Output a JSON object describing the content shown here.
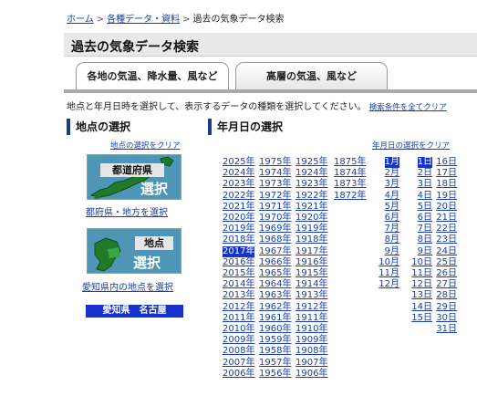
{
  "breadcrumb": {
    "home": "ホーム",
    "data": "各種データ・資料",
    "current": "過去の気象データ検索"
  },
  "page": {
    "title": "過去の気象データ検索"
  },
  "tabs": {
    "surface": "各地の気温、降水量、風など",
    "upper": "高層の気温、風など"
  },
  "instructions": {
    "text": "地点と年月日時を選択して、表示するデータの種類を選択してください。",
    "clear_all": "検索条件を全てクリア"
  },
  "location": {
    "heading": "地点の選択",
    "clear": "地点の選択をクリア",
    "pref_badge": "都道府県",
    "pref_select": "選択",
    "pref_link": "都府県・地方を選択",
    "point_badge": "地点",
    "point_select": "選択",
    "point_link": "愛知県内の地点を選択",
    "current": "愛知県　名古屋"
  },
  "date": {
    "heading": "年月日の選択",
    "clear": "年月日の選択をクリア",
    "years": [
      [
        "2025年",
        "1975年",
        "1925年",
        "1875年"
      ],
      [
        "2024年",
        "1974年",
        "1924年",
        "1874年"
      ],
      [
        "2023年",
        "1973年",
        "1923年",
        "1873年"
      ],
      [
        "2022年",
        "1972年",
        "1922年",
        "1872年"
      ],
      [
        "2021年",
        "1971年",
        "1921年",
        ""
      ],
      [
        "2020年",
        "1970年",
        "1920年",
        ""
      ],
      [
        "2019年",
        "1969年",
        "1919年",
        ""
      ],
      [
        "2018年",
        "1968年",
        "1918年",
        ""
      ],
      [
        "2017年",
        "1967年",
        "1917年",
        ""
      ],
      [
        "2016年",
        "1966年",
        "1916年",
        ""
      ],
      [
        "2015年",
        "1965年",
        "1915年",
        ""
      ],
      [
        "2014年",
        "1964年",
        "1914年",
        ""
      ],
      [
        "2013年",
        "1963年",
        "1913年",
        ""
      ],
      [
        "2012年",
        "1962年",
        "1912年",
        ""
      ],
      [
        "2011年",
        "1961年",
        "1911年",
        ""
      ],
      [
        "2010年",
        "1960年",
        "1910年",
        ""
      ],
      [
        "2009年",
        "1959年",
        "1909年",
        ""
      ],
      [
        "2008年",
        "1958年",
        "1908年",
        ""
      ],
      [
        "2007年",
        "1957年",
        "1907年",
        ""
      ],
      [
        "2006年",
        "1956年",
        "1906年",
        ""
      ]
    ],
    "selected_year": "2017年",
    "months": [
      "1月",
      "2月",
      "3月",
      "4月",
      "5月",
      "6月",
      "7月",
      "8月",
      "9月",
      "10月",
      "11月",
      "12月"
    ],
    "selected_month": "1月",
    "days_col1": [
      "1日",
      "2日",
      "3日",
      "4日",
      "5日",
      "6日",
      "7日",
      "8日",
      "9日",
      "10日",
      "11日",
      "12日",
      "13日",
      "14日",
      "15日"
    ],
    "days_col2": [
      "16日",
      "17日",
      "18日",
      "19日",
      "20日",
      "21日",
      "22日",
      "23日",
      "24日",
      "25日",
      "26日",
      "27日",
      "28日",
      "29日",
      "30日",
      "31日"
    ],
    "selected_day": "1日"
  },
  "colors": {
    "link": "#1a3fa8",
    "selected_bg": "#1533cc",
    "heading_accent": "#1c3b8c",
    "map_bg": "#4f96b6"
  }
}
